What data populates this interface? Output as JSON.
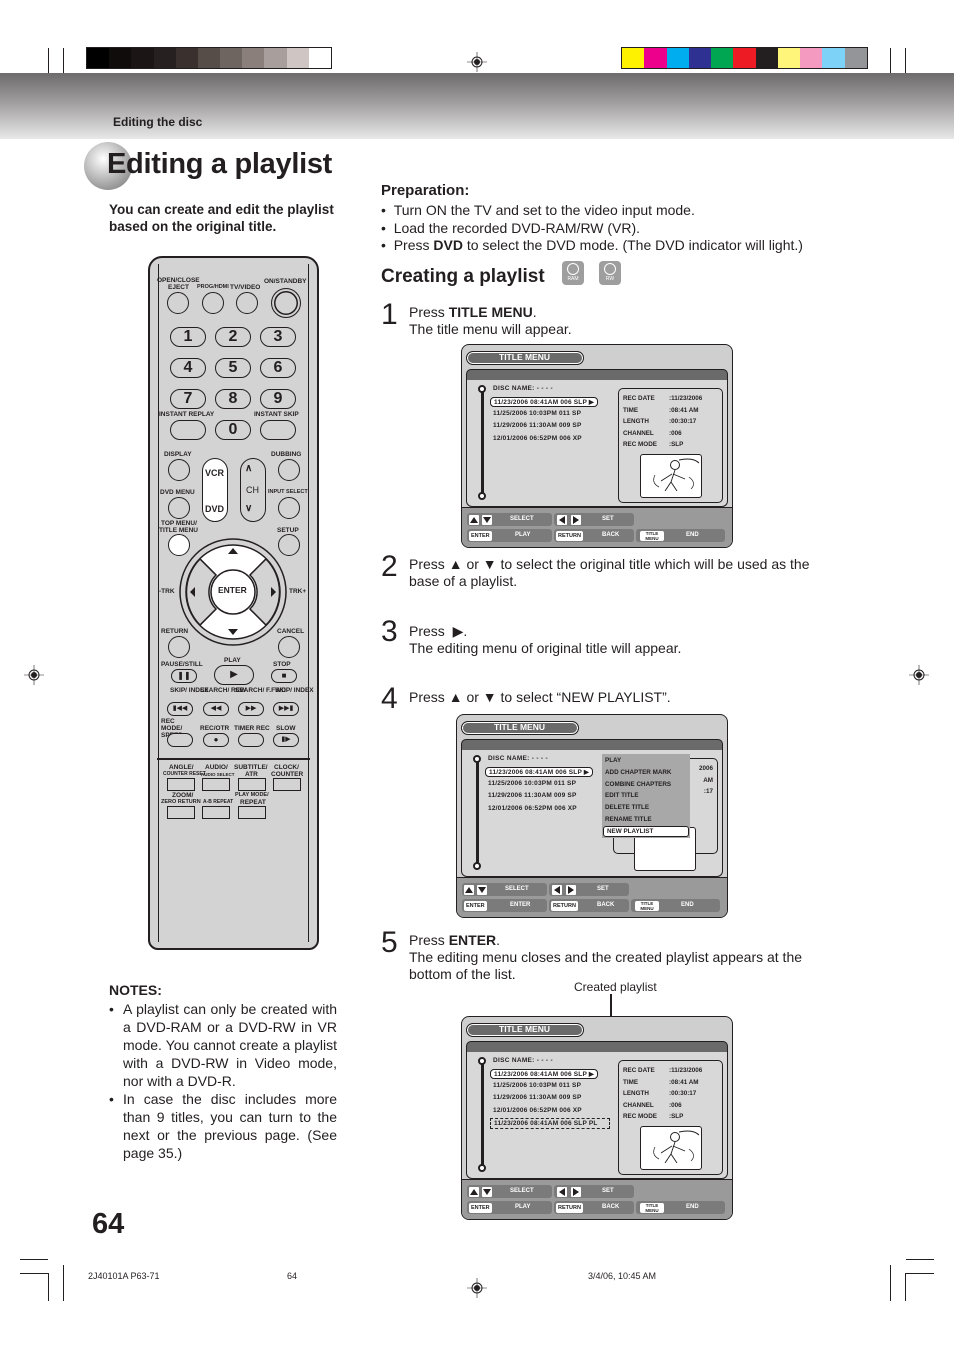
{
  "header": {
    "section": "Editing the disc",
    "grayscale_swatches": [
      "#000000",
      "#0f0c0b",
      "#1b1615",
      "#262020",
      "#3a302d",
      "#564c48",
      "#6e6460",
      "#8a7f7b",
      "#a89e9b",
      "#cfc6c4",
      "#ffffff"
    ],
    "color_swatches": [
      "#fff200",
      "#ec008c",
      "#00aeef",
      "#2e3192",
      "#00a651",
      "#ed1c24",
      "#231f20",
      "#fff57a",
      "#f49ac1",
      "#7dd3f7",
      "#939598"
    ]
  },
  "page": {
    "title": "Editing a playlist",
    "intro": "You can create and edit the playlist based on the original title.",
    "page_number": "64"
  },
  "remote": {
    "labels": {
      "open_close": "OPEN/CLOSE",
      "eject": "EJECT",
      "prog_hdmi": "PROG/HDMI",
      "tv_video": "TV/VIDEO",
      "on_standby": "ON/STANDBY",
      "instant_replay": "INSTANT REPLAY",
      "instant_skip": "INSTANT SKIP",
      "display": "DISPLAY",
      "dubbing": "DUBBING",
      "dvd_menu": "DVD MENU",
      "input_select": "INPUT SELECT",
      "top_menu": "TOP MENU/",
      "title_menu": "TITLE MENU",
      "setup": "SETUP",
      "vcr": "VCR",
      "dvd": "DVD",
      "ch": "CH",
      "enter": "ENTER",
      "trk_minus": "-TRK",
      "trk_plus": "TRK+",
      "return": "RETURN",
      "cancel": "CANCEL",
      "pause_still": "PAUSE/STILL",
      "play": "PLAY",
      "stop": "STOP",
      "skip_index_l": "SKIP/ INDEX",
      "search_rew": "SEARCH/ REW",
      "search_ffwd": "SEARCH/ F.FWD",
      "skip_index_r": "SKIP/ INDEX",
      "rec_mode": "REC MODE/ SPEED",
      "rec_otr": "REC/OTR",
      "timer_rec": "TIMER REC",
      "slow": "SLOW",
      "angle": "ANGLE/",
      "counter_reset": "COUNTER RESET",
      "audio": "AUDIO/",
      "audio_select": "AUDIO SELECT",
      "subtitle": "SUBTITLE/",
      "atr": "ATR",
      "clock": "CLOCK/",
      "counter": "COUNTER",
      "zoom": "ZOOM/",
      "zero_return": "ZERO RETURN",
      "ab_repeat": "A-B REPEAT",
      "play_mode": "PLAY MODE/",
      "repeat": "REPEAT"
    },
    "digits": [
      "1",
      "2",
      "3",
      "4",
      "5",
      "6",
      "7",
      "8",
      "9",
      "0"
    ]
  },
  "preparation": {
    "heading": "Preparation:",
    "items": [
      {
        "pre": "Turn ON the TV and set to the video input mode.",
        "bold": "",
        "post": ""
      },
      {
        "pre": "Load the recorded DVD-RAM/RW (VR).",
        "bold": "",
        "post": ""
      },
      {
        "pre": "Press ",
        "bold": "DVD",
        "post": " to select the DVD mode. (The DVD indicator will light.)"
      }
    ]
  },
  "creating": {
    "heading": "Creating a playlist",
    "disc_icons": [
      "RAM",
      "RW"
    ]
  },
  "steps": [
    {
      "num": "1",
      "line1_pre": "Press ",
      "line1_bold": "TITLE MENU",
      "line1_post": ".",
      "line2": "The title menu will appear."
    },
    {
      "num": "2",
      "pre": "Press",
      "mid": "or",
      "post": "to select the original title which will be used as the",
      "line2": "base of a playlist."
    },
    {
      "num": "3",
      "pre": "Press",
      "post": ".",
      "line2": "The editing menu of original title will appear."
    },
    {
      "num": "4",
      "pre": "Press",
      "mid": "or",
      "post": "to select “NEW PLAYLIST”."
    },
    {
      "num": "5",
      "line1_pre": "Press ",
      "line1_bold": "ENTER",
      "line1_post": ".",
      "line2": "The editing menu closes and the created playlist appears at the",
      "line3": "bottom of the list."
    }
  ],
  "title_menu": {
    "title": "TITLE MENU",
    "disc_name": "DISC NAME: - - - -",
    "titles": [
      "11/23/2006 08:41AM 006 SLP",
      "11/25/2006 10:03PM 011 SP",
      "11/29/2006 11:30AM 009 SP",
      "12/01/2006 06:52PM 006 XP"
    ],
    "created_playlist_row": "11/23/2006 08:41AM 006 SLP PL",
    "info": [
      {
        "k": "REC DATE",
        "v": ":11/23/2006"
      },
      {
        "k": "TIME",
        "v": ":08:41 AM"
      },
      {
        "k": "LENGTH",
        "v": ":00:30:17"
      },
      {
        "k": "CHANNEL",
        "v": ":006"
      },
      {
        "k": "REC MODE",
        "v": ":SLP"
      }
    ],
    "popup_items": [
      "PLAY",
      "ADD CHAPTER MARK",
      "COMBINE CHAPTERS",
      "EDIT TITLE",
      "DELETE TITLE",
      "RENAME TITLE",
      "NEW PLAYLIST"
    ],
    "partial_info": [
      "2006",
      "AM",
      ":17"
    ],
    "controls": {
      "select": "SELECT",
      "set": "SET",
      "enter_key": "ENTER",
      "play": "PLAY",
      "enter": "ENTER",
      "return_key": "RETURN",
      "back": "BACK",
      "title_menu_key": "TITLE MENU",
      "end": "END"
    }
  },
  "callout": "Created playlist",
  "notes": {
    "heading": "NOTES:",
    "items": [
      "A playlist can only be created with a DVD-RAM or a DVD-RW in VR mode. You cannot create a playlist with a DVD-RW in Video mode, nor with a DVD-R.",
      "In case the disc includes more than 9 titles, you can turn to the next or the previous page. (See page 35.)"
    ]
  },
  "footer": {
    "doc_code": "2J40101A P63-71",
    "page": "64",
    "timestamp": "3/4/06, 10:45 AM"
  }
}
